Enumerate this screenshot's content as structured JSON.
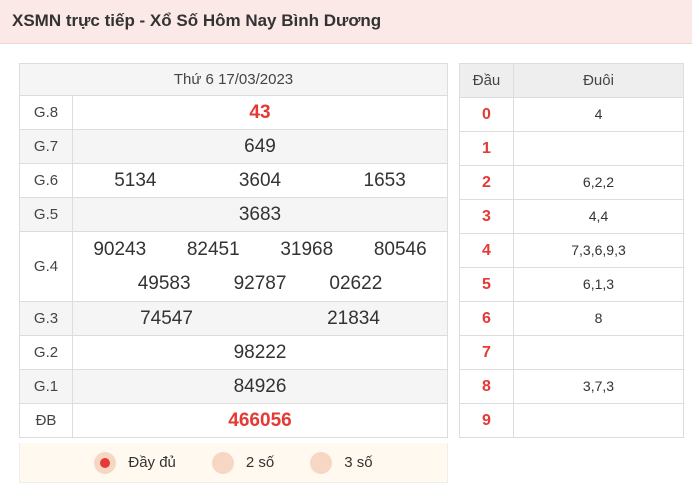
{
  "page_title": "XSMN trực tiếp - Xổ Số Hôm Nay Bình Dương",
  "results": {
    "date": "Thứ 6 17/03/2023",
    "prizes": [
      {
        "label": "G.8",
        "numbers": [
          "43"
        ]
      },
      {
        "label": "G.7",
        "numbers": [
          "649"
        ]
      },
      {
        "label": "G.6",
        "numbers": [
          "5134",
          "3604",
          "1653"
        ]
      },
      {
        "label": "G.5",
        "numbers": [
          "3683"
        ]
      },
      {
        "label": "G.4",
        "numbers": [
          "90243",
          "82451",
          "31968",
          "80546",
          "49583",
          "92787",
          "02622"
        ]
      },
      {
        "label": "G.3",
        "numbers": [
          "74547",
          "21834"
        ]
      },
      {
        "label": "G.2",
        "numbers": [
          "98222"
        ]
      },
      {
        "label": "G.1",
        "numbers": [
          "84926"
        ]
      },
      {
        "label": "ĐB",
        "numbers": [
          "466056"
        ]
      }
    ]
  },
  "options": [
    {
      "label": "Đầy đủ",
      "selected": true
    },
    {
      "label": "2 số",
      "selected": false
    },
    {
      "label": "3 số",
      "selected": false
    }
  ],
  "loto": {
    "head_label": "Đầu",
    "tail_label": "Đuôi",
    "rows": [
      {
        "dau": "0",
        "duoi": "4"
      },
      {
        "dau": "1",
        "duoi": ""
      },
      {
        "dau": "2",
        "duoi": "6,2,2"
      },
      {
        "dau": "3",
        "duoi": "4,4"
      },
      {
        "dau": "4",
        "duoi": "7,3,6,9,3"
      },
      {
        "dau": "5",
        "duoi": "6,1,3"
      },
      {
        "dau": "6",
        "duoi": "8"
      },
      {
        "dau": "7",
        "duoi": ""
      },
      {
        "dau": "8",
        "duoi": "3,7,3"
      },
      {
        "dau": "9",
        "duoi": ""
      }
    ]
  },
  "colors": {
    "accent": "#e53935",
    "header_bg": "#fbe9e7",
    "radio_bg": "#f7d7c4"
  }
}
